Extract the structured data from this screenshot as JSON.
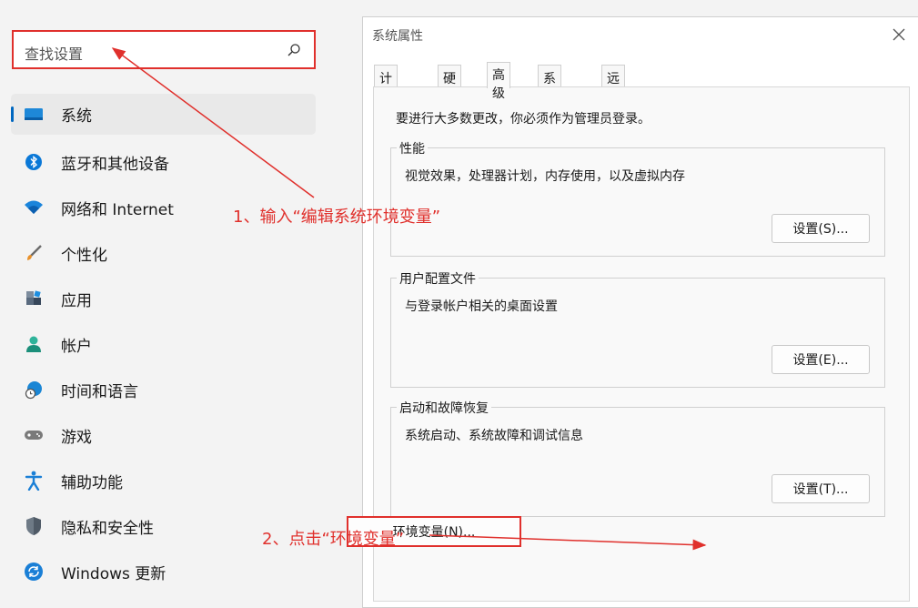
{
  "search": {
    "placeholder": "查找设置"
  },
  "nav": {
    "items": [
      {
        "label": "系统",
        "icon": "monitor-icon"
      },
      {
        "label": "蓝牙和其他设备",
        "icon": "bluetooth-icon"
      },
      {
        "label": "网络和 Internet",
        "icon": "wifi-icon"
      },
      {
        "label": "个性化",
        "icon": "brush-icon"
      },
      {
        "label": "应用",
        "icon": "apps-icon"
      },
      {
        "label": "帐户",
        "icon": "account-icon"
      },
      {
        "label": "时间和语言",
        "icon": "globe-clock-icon"
      },
      {
        "label": "游戏",
        "icon": "gamepad-icon"
      },
      {
        "label": "辅助功能",
        "icon": "accessibility-icon"
      },
      {
        "label": "隐私和安全性",
        "icon": "shield-icon"
      },
      {
        "label": "Windows 更新",
        "icon": "update-icon"
      }
    ]
  },
  "dialog": {
    "title": "系统属性",
    "tabs": [
      "计算机名",
      "硬件",
      "高级",
      "系统保护",
      "远程"
    ],
    "active_tab": "高级",
    "intro": "要进行大多数更改，你必须作为管理员登录。",
    "performance": {
      "title": "性能",
      "desc": "视觉效果，处理器计划，内存使用，以及虚拟内存",
      "button": "设置(S)..."
    },
    "profiles": {
      "title": "用户配置文件",
      "desc": "与登录帐户相关的桌面设置",
      "button": "设置(E)..."
    },
    "startup": {
      "title": "启动和故障恢复",
      "desc": "系统启动、系统故障和调试信息",
      "button": "设置(T)..."
    },
    "env_button": "环境变量(N)..."
  },
  "annotations": {
    "step1": "1、输入“编辑系统环境变量”",
    "step2": "2、点击“环境变量”",
    "color": "#e0302c"
  },
  "colors": {
    "accent": "#0067c0",
    "highlight": "#e0302c"
  }
}
